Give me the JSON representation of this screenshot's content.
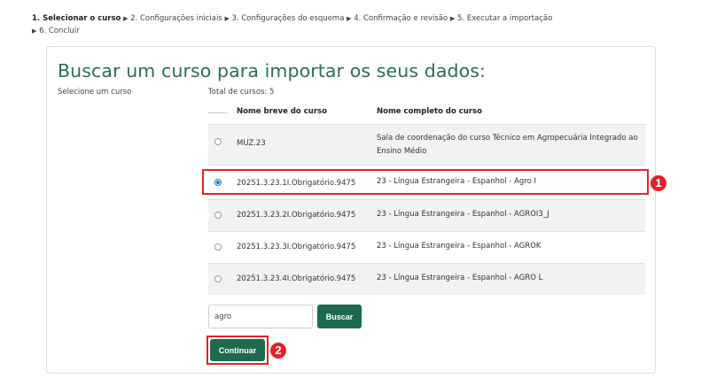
{
  "steps": {
    "current": "1. Selecionar o curso",
    "others": [
      "2. Configurações iniciais",
      "3. Configurações do esquema",
      "4. Confirmação e revisão",
      "5. Executar a importação",
      "6. Concluir"
    ],
    "separator": "▶"
  },
  "heading": "Buscar um curso para importar os seus dados:",
  "select_label": "Selecione um curso",
  "total": "Total de cursos: 5",
  "table": {
    "headers": {
      "short": "Nome breve do curso",
      "full": "Nome completo do curso"
    },
    "rows": [
      {
        "short": "MUZ.23",
        "full": "Sala de coordenação do curso Técnico em Agropecuária Integrado ao Ensino Médio",
        "selected": false
      },
      {
        "short": "20251.3.23.1I.Obrigatório.9475",
        "full": "23 - Língua Estrangeira - Espanhol - Agro I",
        "selected": true
      },
      {
        "short": "20251.3.23.2I.Obrigatório.9475",
        "full": "23 - Língua Estrangeira - Espanhol - AGROI3_J",
        "selected": false
      },
      {
        "short": "20251.3.23.3I.Obrigatório.9475",
        "full": "23 - Língua Estrangeira - Espanhol - AGROK",
        "selected": false
      },
      {
        "short": "20251.3.23.4I.Obrigatório.9475",
        "full": "23 - Língua Estrangeira - Espanhol - AGRO L",
        "selected": false
      }
    ]
  },
  "search": {
    "value": "agro",
    "button": "Buscar"
  },
  "continue_button": "Continuar",
  "badges": {
    "first": "1",
    "second": "2"
  },
  "colors": {
    "accent": "#1f6a4e",
    "heading": "#2c6e55",
    "highlight": "#e3222b",
    "radio": "#1a73e8"
  }
}
